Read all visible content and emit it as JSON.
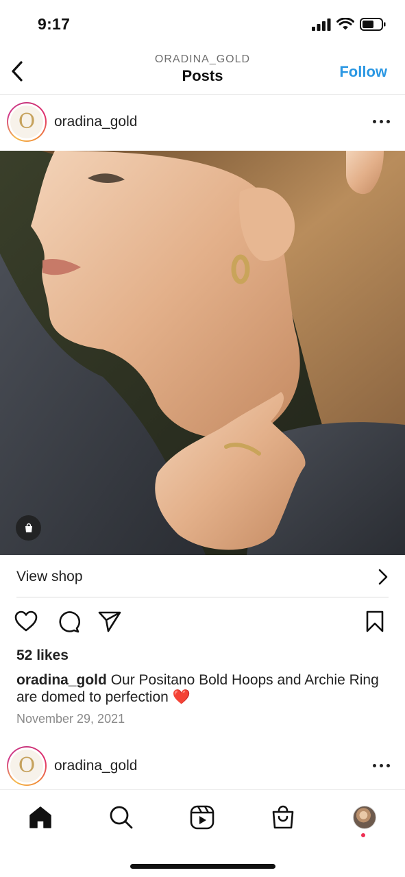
{
  "status_bar": {
    "time": "9:17"
  },
  "header": {
    "subtitle": "ORADINA_GOLD",
    "title": "Posts",
    "follow_label": "Follow"
  },
  "posts": [
    {
      "username": "oradina_gold",
      "avatar_letter": "O",
      "view_shop_label": "View shop",
      "likes": "52 likes",
      "caption_username": "oradina_gold",
      "caption_text": "Our Positano Bold Hoops and Archie Ring are domed to perfection",
      "caption_emoji": "❤️",
      "date": "November 29, 2021"
    },
    {
      "username": "oradina_gold",
      "avatar_letter": "O"
    }
  ],
  "icons": {
    "back": "chevron-left-icon",
    "more": "more-horizontal-icon",
    "shop_tag": "shopping-bag-icon",
    "like": "heart-icon",
    "comment": "comment-icon",
    "share": "send-icon",
    "save": "bookmark-icon",
    "nav": [
      "home-icon",
      "search-icon",
      "reels-icon",
      "shop-icon",
      "profile-avatar"
    ]
  },
  "colors": {
    "follow": "#2a97e3",
    "notification_dot": "#ee2f54",
    "avatar_ring": "#d23b8a"
  }
}
